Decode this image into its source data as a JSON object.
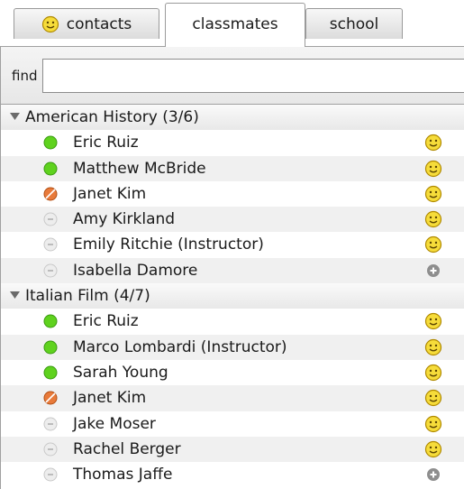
{
  "tabs": [
    {
      "label": "contacts",
      "icon": "smiley-icon",
      "active": false
    },
    {
      "label": "classmates",
      "active": true
    },
    {
      "label": "school",
      "active": false
    }
  ],
  "search": {
    "label": "find",
    "value": "",
    "placeholder": ""
  },
  "groups": [
    {
      "name": "American History",
      "count": "(3/6)",
      "members": [
        {
          "name": "Eric Ruiz",
          "status": "online",
          "action": "smiley"
        },
        {
          "name": "Matthew McBride",
          "status": "online",
          "action": "smiley"
        },
        {
          "name": "Janet Kim",
          "status": "busy",
          "action": "smiley"
        },
        {
          "name": "Amy Kirkland",
          "status": "offline",
          "action": "smiley"
        },
        {
          "name": "Emily Ritchie (Instructor)",
          "status": "offline",
          "action": "smiley"
        },
        {
          "name": "Isabella Damore",
          "status": "offline",
          "action": "add"
        }
      ]
    },
    {
      "name": "Italian Film",
      "count": "(4/7)",
      "members": [
        {
          "name": "Eric Ruiz",
          "status": "online",
          "action": "smiley"
        },
        {
          "name": "Marco Lombardi (Instructor)",
          "status": "online",
          "action": "smiley"
        },
        {
          "name": "Sarah Young",
          "status": "online",
          "action": "smiley"
        },
        {
          "name": "Janet Kim",
          "status": "busy",
          "action": "smiley"
        },
        {
          "name": "Jake Moser",
          "status": "offline",
          "action": "smiley"
        },
        {
          "name": "Rachel Berger",
          "status": "offline",
          "action": "smiley"
        },
        {
          "name": "Thomas Jaffe",
          "status": "offline",
          "action": "add"
        }
      ]
    }
  ],
  "colors": {
    "online": "#5fd21e",
    "busy": "#e87a3a",
    "offline": "#c9c9c9",
    "smiley": "#f6dc3a",
    "add": "#8e8e8e"
  }
}
